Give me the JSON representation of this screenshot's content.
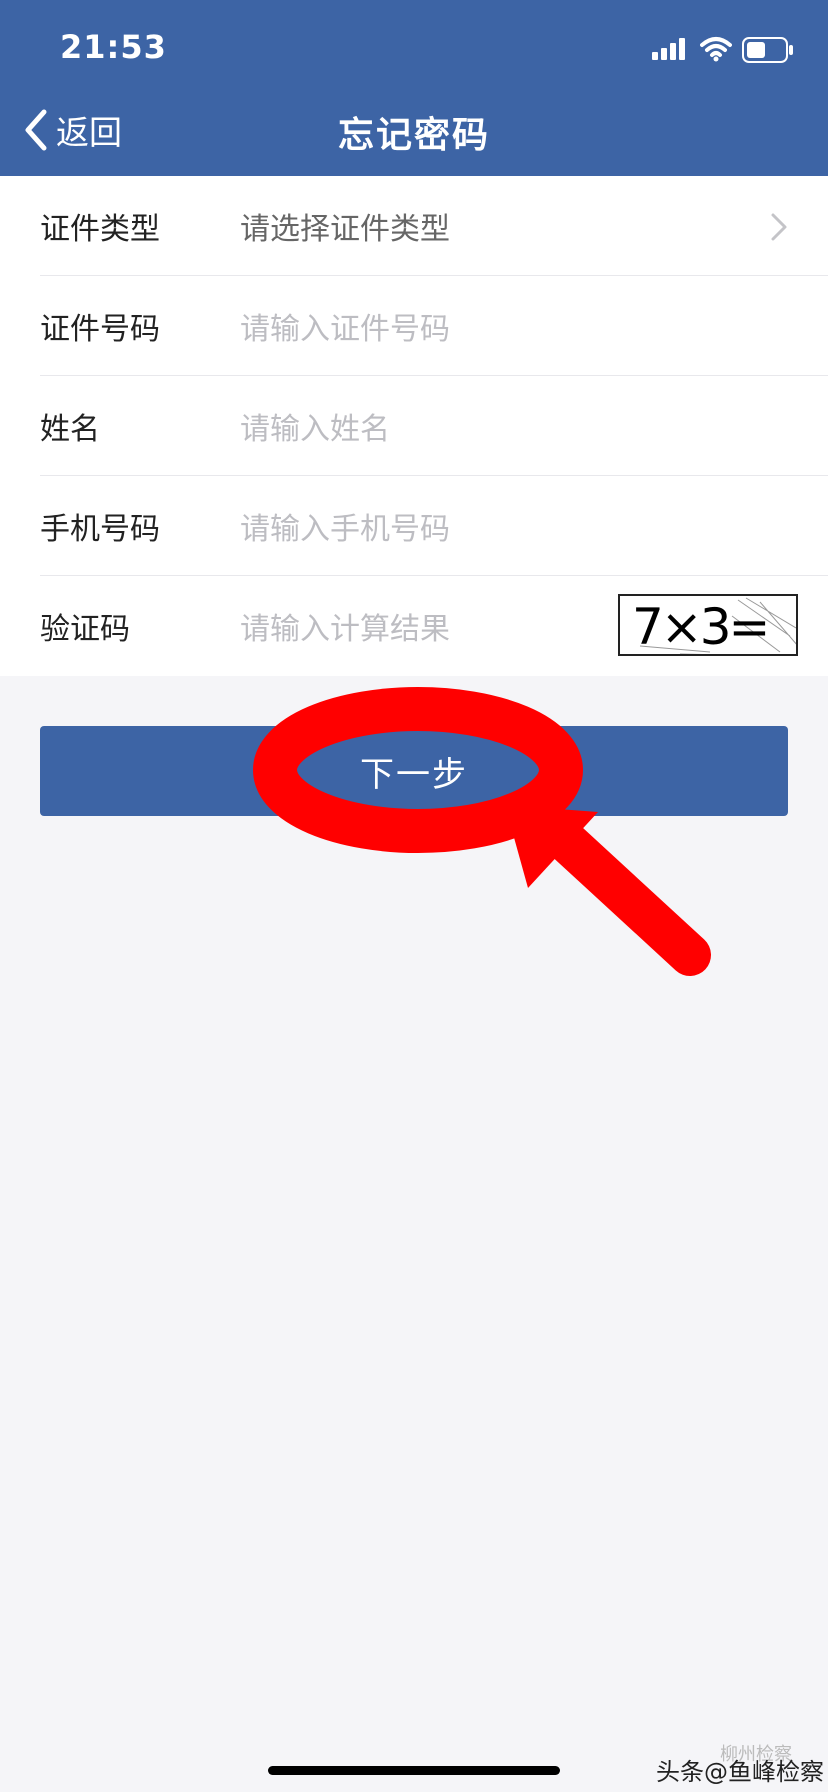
{
  "status_bar": {
    "time": "21:53"
  },
  "nav": {
    "back_label": "返回",
    "title": "忘记密码"
  },
  "form": {
    "rows": [
      {
        "label": "证件类型",
        "placeholder": "请选择证件类型",
        "type": "select"
      },
      {
        "label": "证件号码",
        "placeholder": "请输入证件号码",
        "type": "input"
      },
      {
        "label": "姓名",
        "placeholder": "请输入姓名",
        "type": "input"
      },
      {
        "label": "手机号码",
        "placeholder": "请输入手机号码",
        "type": "input"
      },
      {
        "label": "验证码",
        "placeholder": "请输入计算结果",
        "type": "input"
      }
    ],
    "captcha_text": "7×3="
  },
  "next_button": {
    "label": "下一步"
  },
  "watermark": {
    "text": "头条@鱼峰检察",
    "sub_text": "柳州检察"
  },
  "colors": {
    "primary": "#3d64a5",
    "annotation": "#ff0000",
    "background": "#f5f5f8"
  },
  "icons": {
    "back": "chevron-left-icon",
    "select": "chevron-right-icon",
    "wifi": "wifi-icon",
    "battery": "battery-icon",
    "signal": "signal-icon"
  }
}
